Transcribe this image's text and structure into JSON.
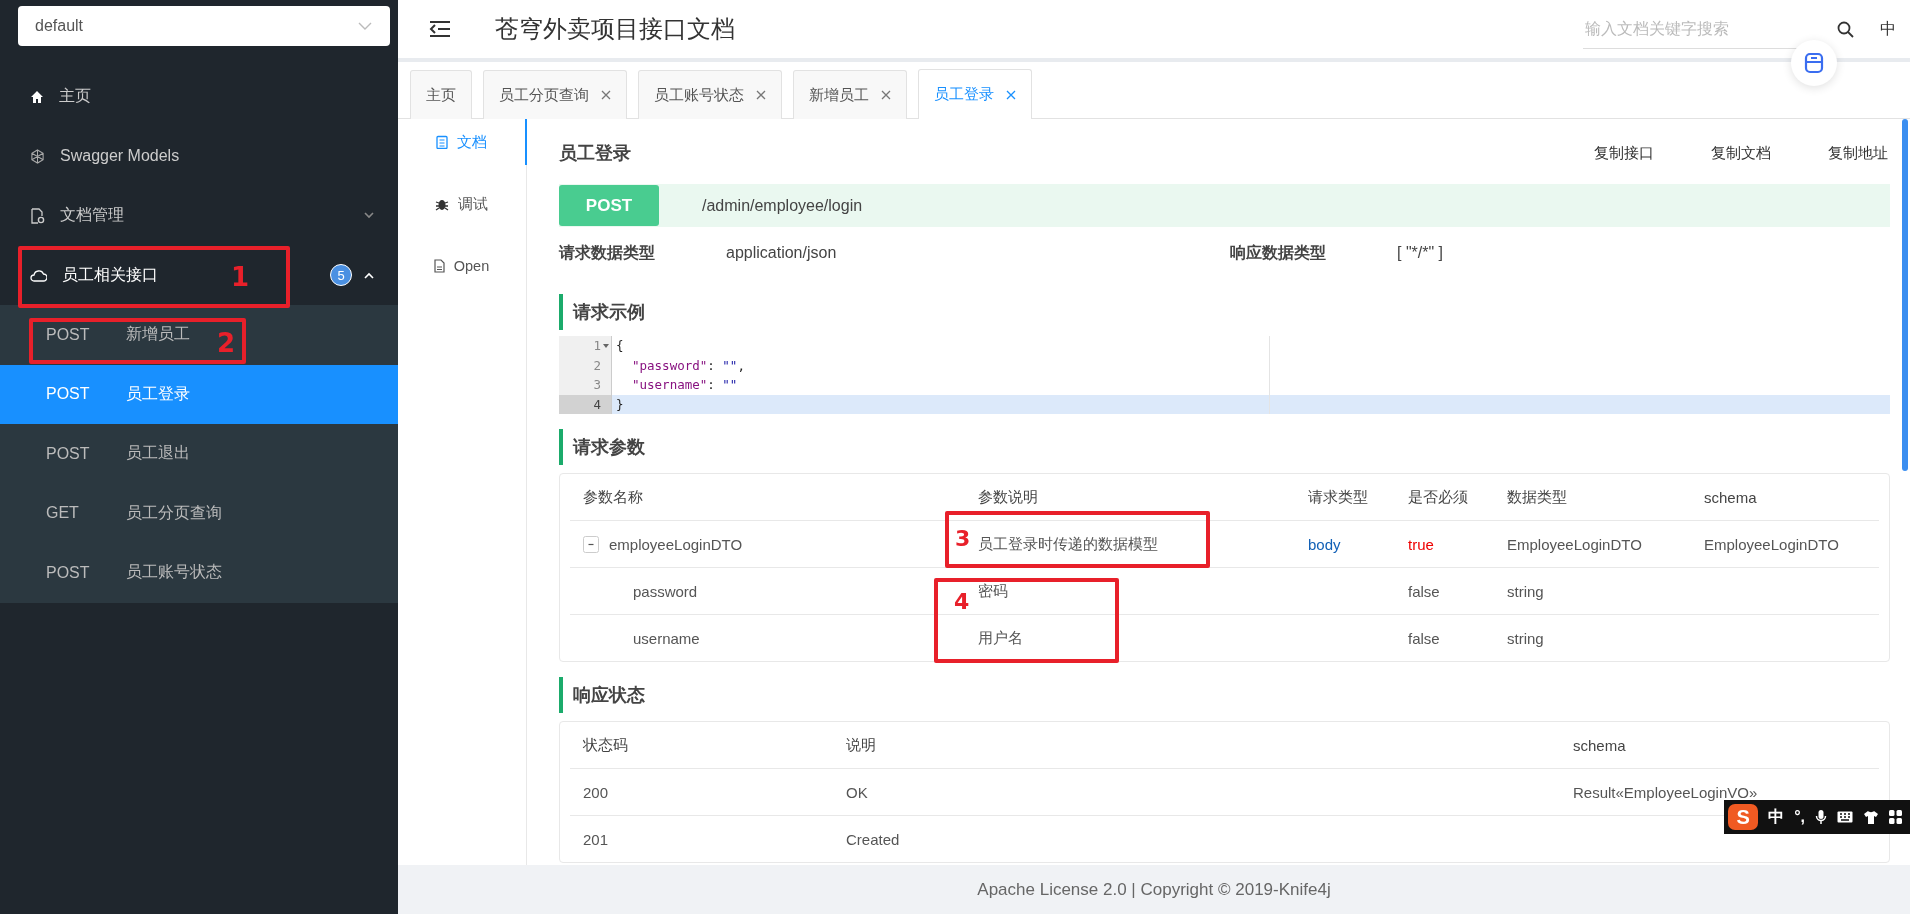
{
  "sidebar": {
    "group_select": {
      "value": "default"
    },
    "items": [
      {
        "kind": "link",
        "label": "主页"
      },
      {
        "kind": "link",
        "label": "Swagger Models"
      },
      {
        "kind": "menu",
        "label": "文档管理",
        "expanded": false
      },
      {
        "kind": "menu",
        "label": "员工相关接口",
        "expanded": true,
        "badge": "5",
        "annotation": "1",
        "children": [
          {
            "method": "POST",
            "label": "新增员工",
            "selected": false,
            "annotation": "2"
          },
          {
            "method": "POST",
            "label": "员工登录",
            "selected": true
          },
          {
            "method": "POST",
            "label": "员工退出",
            "selected": false
          },
          {
            "method": "GET",
            "label": "员工分页查询",
            "selected": false
          },
          {
            "method": "POST",
            "label": "员工账号状态",
            "selected": false
          }
        ]
      }
    ]
  },
  "header": {
    "title": "苍穹外卖项目接口文档",
    "search": {
      "placeholder": "输入文档关键字搜索"
    },
    "language": "中"
  },
  "tabs": [
    {
      "label": "主页",
      "closable": false,
      "selected": false
    },
    {
      "label": "员工分页查询",
      "closable": true,
      "selected": false
    },
    {
      "label": "员工账号状态",
      "closable": true,
      "selected": false
    },
    {
      "label": "新增员工",
      "closable": true,
      "selected": false
    },
    {
      "label": "员工登录",
      "closable": true,
      "selected": true
    }
  ],
  "side_tabs": [
    {
      "label": "文档",
      "selected": true
    },
    {
      "label": "调试",
      "selected": false
    },
    {
      "label": "Open",
      "selected": false
    }
  ],
  "api": {
    "title": "员工登录",
    "actions": [
      "复制接口",
      "复制文档",
      "复制地址"
    ],
    "method": "POST",
    "path": "/admin/employee/login",
    "request_type_label": "请求数据类型",
    "request_type": "application/json",
    "response_type_label": "响应数据类型",
    "response_type": "[ \"*/*\" ]"
  },
  "example": {
    "heading": "请求示例",
    "lines": [
      {
        "number": "1",
        "foldable": true,
        "active": false,
        "tokens": [
          {
            "kind": "punct",
            "text": "{"
          }
        ]
      },
      {
        "number": "2",
        "foldable": false,
        "active": false,
        "tokens": [
          {
            "kind": "key",
            "text": "\"password\""
          },
          {
            "kind": "punct",
            "text": ": "
          },
          {
            "kind": "string",
            "text": "\"\""
          },
          {
            "kind": "punct",
            "text": ","
          }
        ]
      },
      {
        "number": "3",
        "foldable": false,
        "active": false,
        "tokens": [
          {
            "kind": "key",
            "text": "\"username\""
          },
          {
            "kind": "punct",
            "text": ": "
          },
          {
            "kind": "string",
            "text": "\"\""
          }
        ]
      },
      {
        "number": "4",
        "foldable": false,
        "active": true,
        "tokens": [
          {
            "kind": "punct",
            "text": "}"
          }
        ]
      }
    ]
  },
  "params": {
    "heading": "请求参数",
    "columns": [
      "参数名称",
      "参数说明",
      "请求类型",
      "是否必须",
      "数据类型",
      "schema"
    ],
    "rows": [
      {
        "name": "employeeLoginDTO",
        "description": "员工登录时传递的数据模型",
        "in": "body",
        "required": "true",
        "type": "EmployeeLoginDTO",
        "schema": "EmployeeLoginDTO",
        "expanded": true,
        "annotation": "3",
        "children": [
          {
            "name": "password",
            "description": "密码",
            "required": "false",
            "type": "string",
            "annotation": "4"
          },
          {
            "name": "username",
            "description": "用户名",
            "required": "false",
            "type": "string"
          }
        ]
      }
    ]
  },
  "responses": {
    "heading": "响应状态",
    "columns": [
      "状态码",
      "说明",
      "schema"
    ],
    "rows": [
      {
        "code": "200",
        "description": "OK",
        "schema": "Result«EmployeeLoginVO»"
      },
      {
        "code": "201",
        "description": "Created"
      }
    ]
  },
  "footer": {
    "text": "Apache License 2.0 | Copyright © 2019-Knife4j"
  },
  "ime_toolbar": {
    "logo": "S",
    "mode": "中",
    "punct": "°,"
  }
}
